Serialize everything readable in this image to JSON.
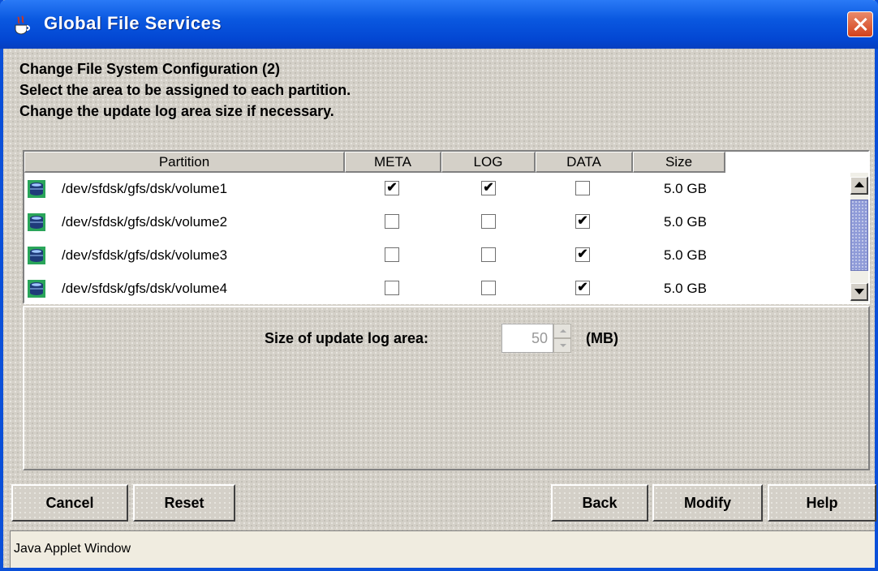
{
  "window": {
    "title": "Global File Services"
  },
  "instructions": {
    "line1": "Change File System Configuration (2)",
    "line2": "Select the area to be assigned to each partition.",
    "line3": "Change the update log area size if necessary."
  },
  "table": {
    "headers": {
      "partition": "Partition",
      "meta": "META",
      "log": "LOG",
      "data": "DATA",
      "size": "Size"
    },
    "rows": [
      {
        "partition": "/dev/sfdsk/gfs/dsk/volume1",
        "meta": "✔",
        "log": "✔",
        "data": "",
        "size": "5.0 GB"
      },
      {
        "partition": "/dev/sfdsk/gfs/dsk/volume2",
        "meta": "",
        "log": "",
        "data": "✔",
        "size": "5.0 GB"
      },
      {
        "partition": "/dev/sfdsk/gfs/dsk/volume3",
        "meta": "",
        "log": "",
        "data": "✔",
        "size": "5.0 GB"
      },
      {
        "partition": "/dev/sfdsk/gfs/dsk/volume4",
        "meta": "",
        "log": "",
        "data": "✔",
        "size": "5.0 GB"
      }
    ]
  },
  "log_area": {
    "label": "Size of update log area:",
    "value": "50",
    "unit": "(MB)"
  },
  "buttons": {
    "cancel": "Cancel",
    "reset": "Reset",
    "back": "Back",
    "modify": "Modify",
    "help": "Help"
  },
  "statusbar": {
    "text": "Java Applet Window"
  },
  "icons": {
    "title": "java-coffee-icon",
    "close": "close-icon",
    "partition": "disk-drive-icon"
  },
  "colors": {
    "titlebar": "#0a58e0",
    "close_button": "#d3411b",
    "scroll_thumb": "#8f9bd8",
    "drive_icon": "#2aa55a"
  }
}
